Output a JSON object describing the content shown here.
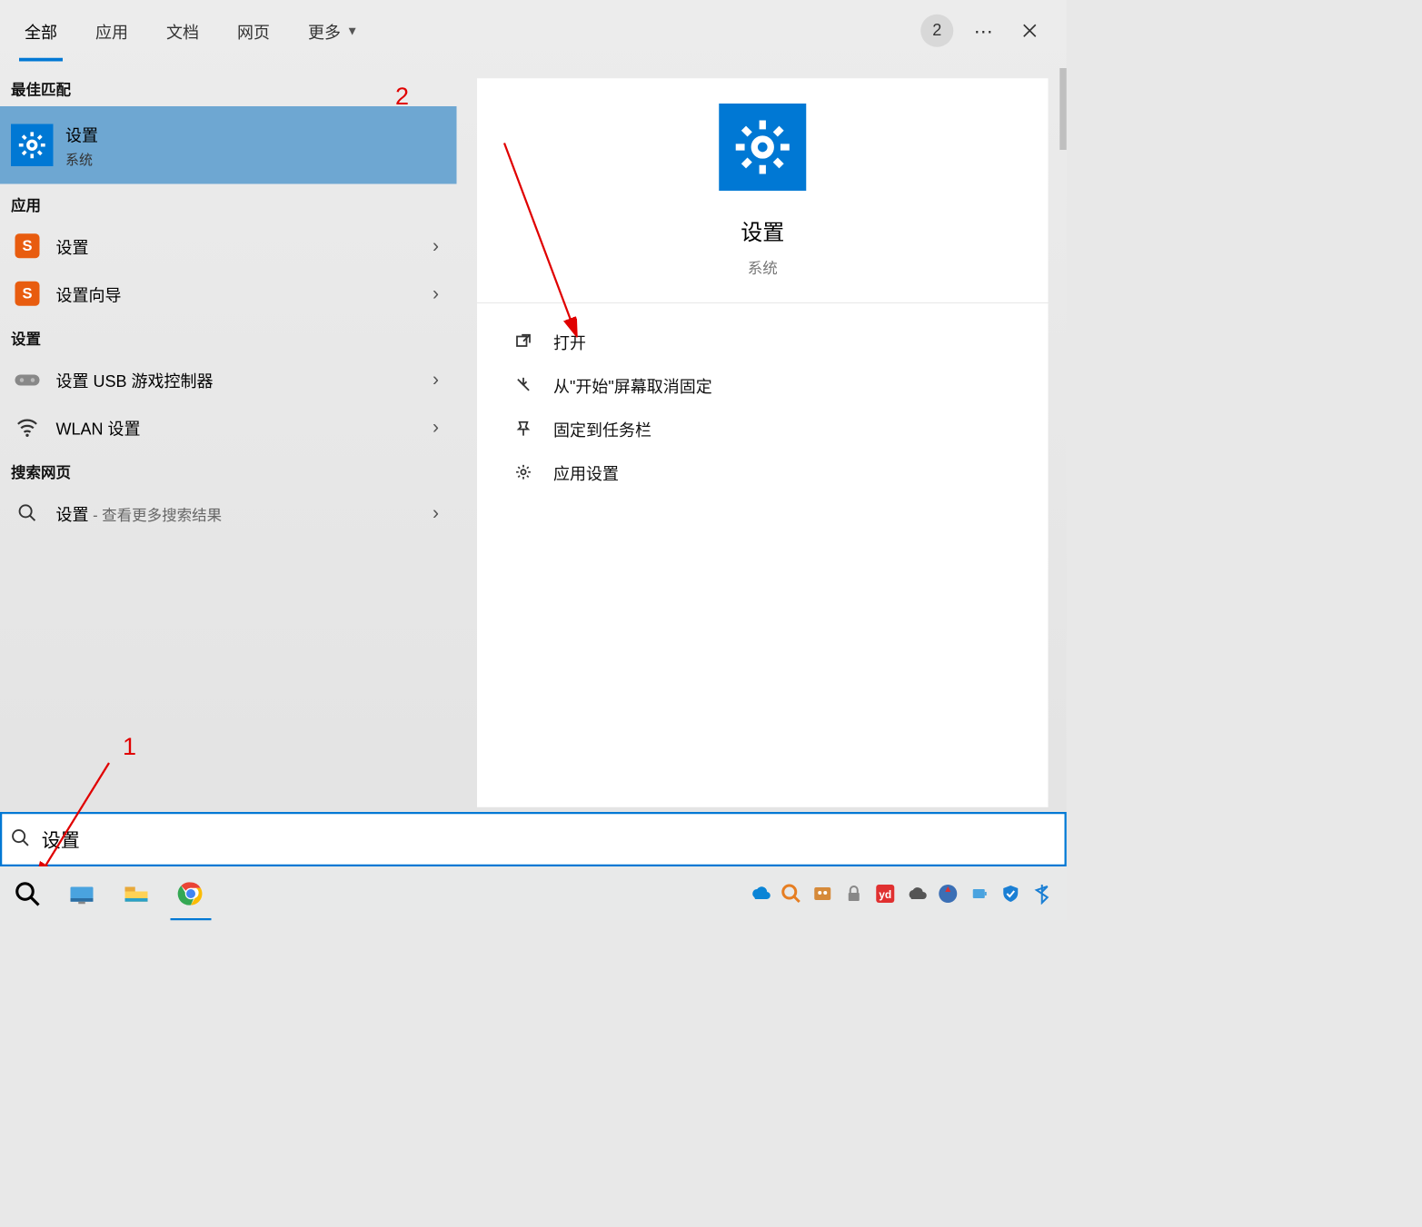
{
  "tabs": {
    "all": "全部",
    "apps": "应用",
    "docs": "文档",
    "web": "网页",
    "more": "更多"
  },
  "topRight": {
    "badge": "2",
    "more": "⋯"
  },
  "sections": {
    "bestMatch": "最佳匹配",
    "apps": "应用",
    "settings": "设置",
    "web": "搜索网页"
  },
  "results": {
    "settings": {
      "title": "设置",
      "subtitle": "系统"
    },
    "sogouSettings": {
      "title": "设置"
    },
    "sogouWizard": {
      "title": "设置向导"
    },
    "usb": {
      "title": "设置 USB 游戏控制器"
    },
    "wlan": {
      "title": "WLAN 设置"
    },
    "webSearch": {
      "title": "设置",
      "trailing": " - 查看更多搜索结果"
    }
  },
  "preview": {
    "title": "设置",
    "subtitle": "系统",
    "actions": {
      "open": "打开",
      "unpinStart": "从\"开始\"屏幕取消固定",
      "pinTaskbar": "固定到任务栏",
      "appSettings": "应用设置"
    }
  },
  "search": {
    "value": "设置"
  },
  "annotations": {
    "one": "1",
    "two": "2"
  }
}
